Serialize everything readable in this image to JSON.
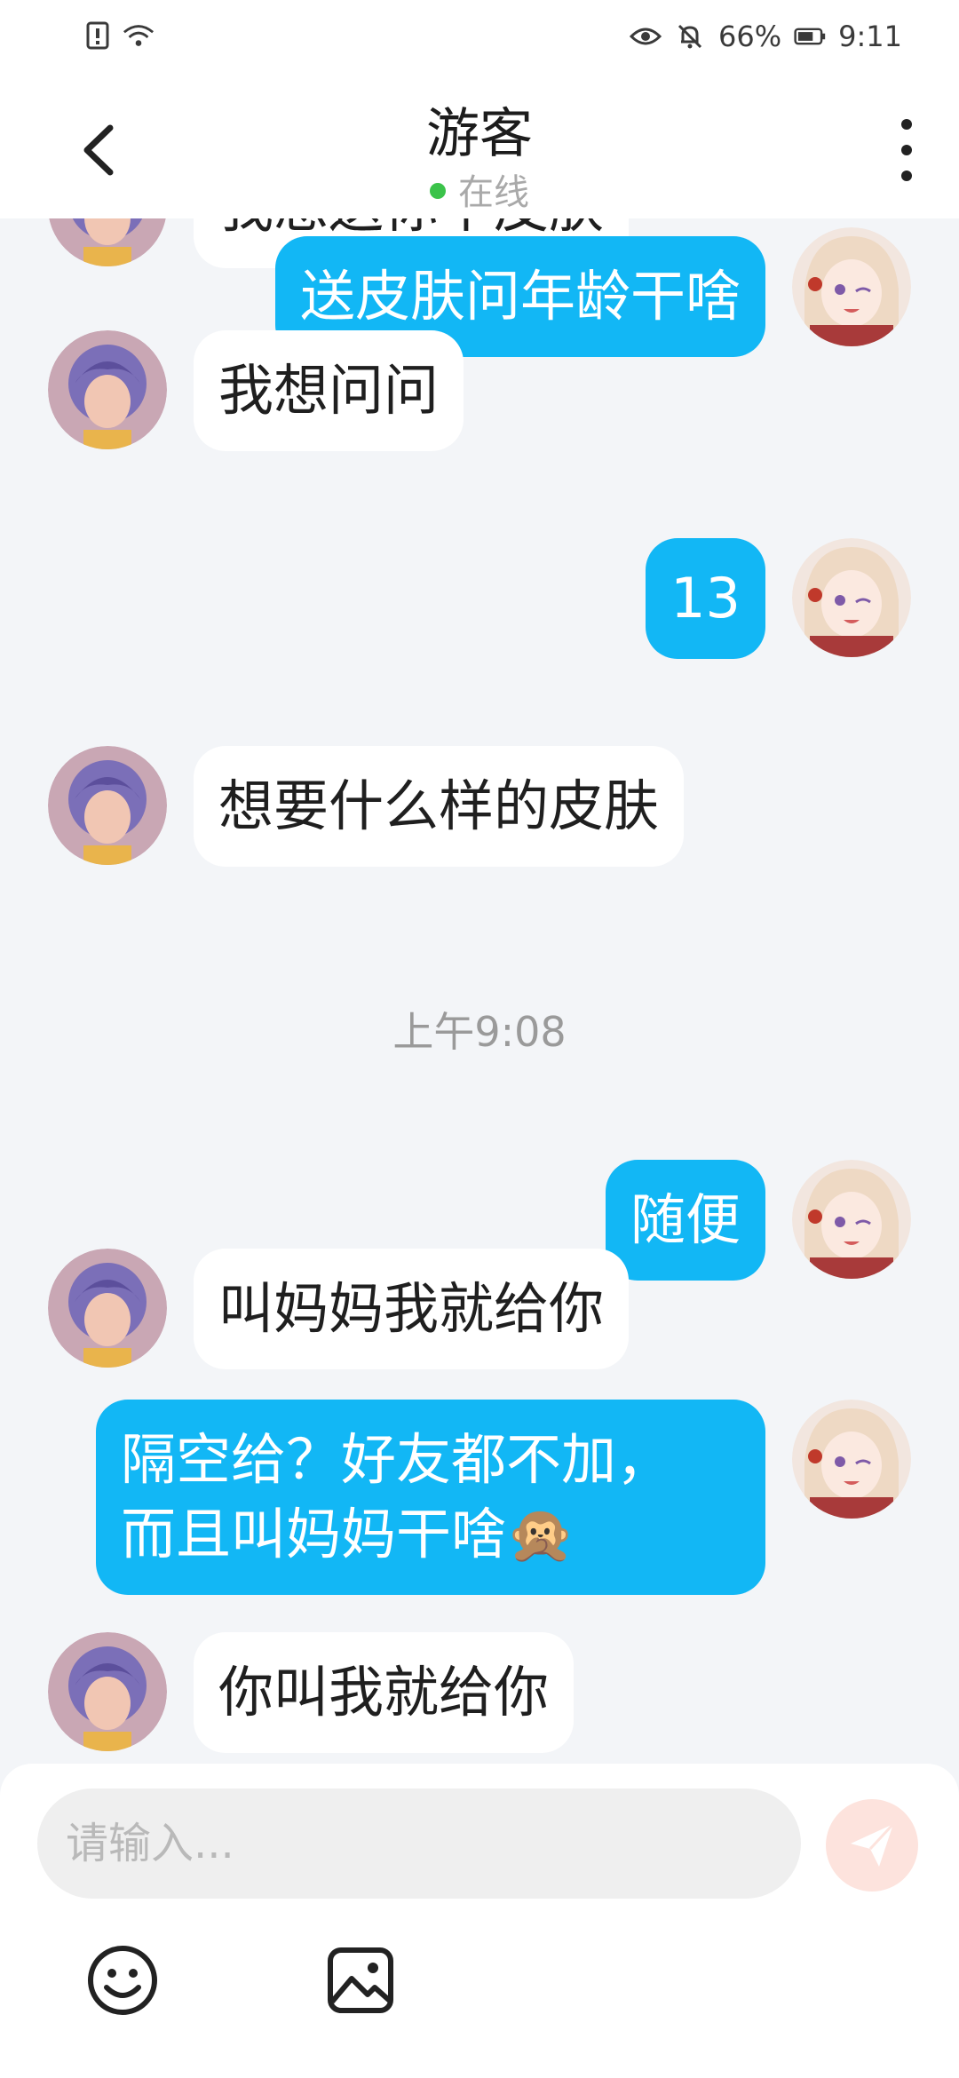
{
  "status_bar": {
    "battery": "66%",
    "time": "9:11",
    "icons": [
      "sim-alert-icon",
      "wifi-icon",
      "eye-icon",
      "mute-icon",
      "battery-icon"
    ]
  },
  "header": {
    "title": "游客",
    "presence": "在线",
    "presence_color": "#3bc34a"
  },
  "messages": [
    {
      "side": "in",
      "text": "我想送你个皮肤"
    },
    {
      "side": "out",
      "text": "送皮肤问年龄干啥"
    },
    {
      "side": "in",
      "text": "我想问问"
    },
    {
      "side": "out",
      "text": "13"
    },
    {
      "side": "in",
      "text": "想要什么样的皮肤"
    },
    {
      "side": "out",
      "text": "随便"
    },
    {
      "side": "in",
      "text": "叫妈妈我就给你"
    },
    {
      "side": "out",
      "text": "隔空给？好友都不加，\n而且叫妈妈干啥",
      "emoji": "🙊"
    },
    {
      "side": "in",
      "text": "你叫我就给你"
    }
  ],
  "timestamp": "上午9:08",
  "composer": {
    "placeholder": "请输入..."
  },
  "colors": {
    "outgoing_bubble": "#12b7f5",
    "incoming_bubble": "#ffffff",
    "background": "#f3f5f8",
    "send_button": "#fde3dd"
  }
}
